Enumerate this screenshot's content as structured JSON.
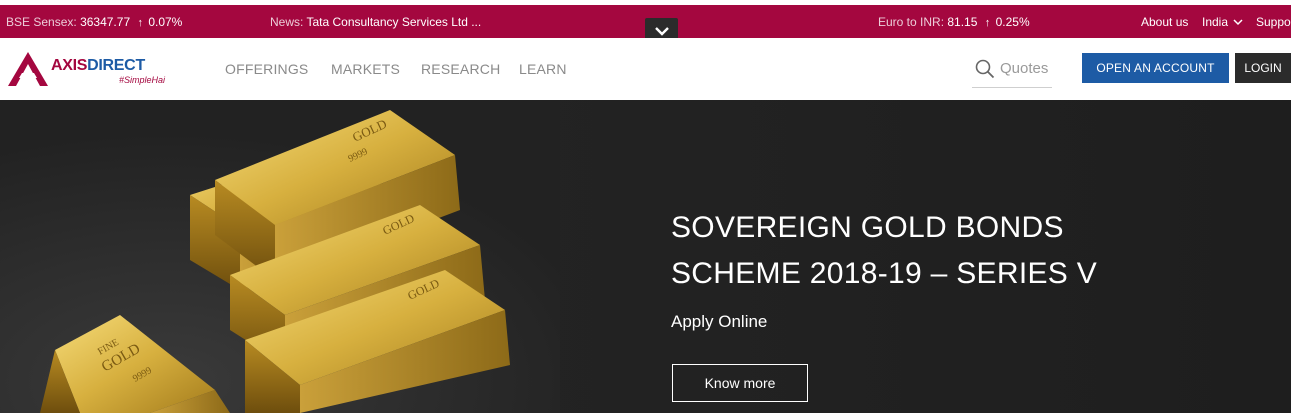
{
  "ticker": {
    "sensex_label": "BSE Sensex:",
    "sensex_value": "36347.77",
    "sensex_change": "0.07%",
    "news_label": "News:",
    "news_text": "Tata Consultancy Services Ltd ...",
    "euro_label": "Euro to INR:",
    "euro_value": "81.15",
    "euro_change": "0.25%",
    "about": "About us",
    "country": "India",
    "support": "Suppo"
  },
  "header": {
    "logo_axis": "AXIS",
    "logo_direct": "DIRECT",
    "logo_tagline": "#SimpleHai",
    "nav": [
      "OFFERINGS",
      "MARKETS",
      "RESEARCH",
      "LEARN"
    ],
    "search_placeholder": "Quotes",
    "open_account": "OPEN AN ACCOUNT",
    "login": "LOGIN"
  },
  "hero": {
    "title_line1": "SOVEREIGN GOLD BONDS",
    "title_line2": "SCHEME 2018-19 – SERIES V",
    "subtitle": "Apply Online",
    "cta": "Know more",
    "bar_text_fine": "FINE",
    "bar_text_gold": "GOLD",
    "bar_text_purity": "9999"
  },
  "colors": {
    "brand": "#a4073f",
    "primary_button": "#1d5ba5",
    "login_button": "#2b2b2b",
    "hero_bg": "#232323",
    "gold": "#c9a133"
  },
  "icons": [
    "arrow-up-icon",
    "chevron-down-icon",
    "search-icon",
    "logo-mark-icon"
  ]
}
